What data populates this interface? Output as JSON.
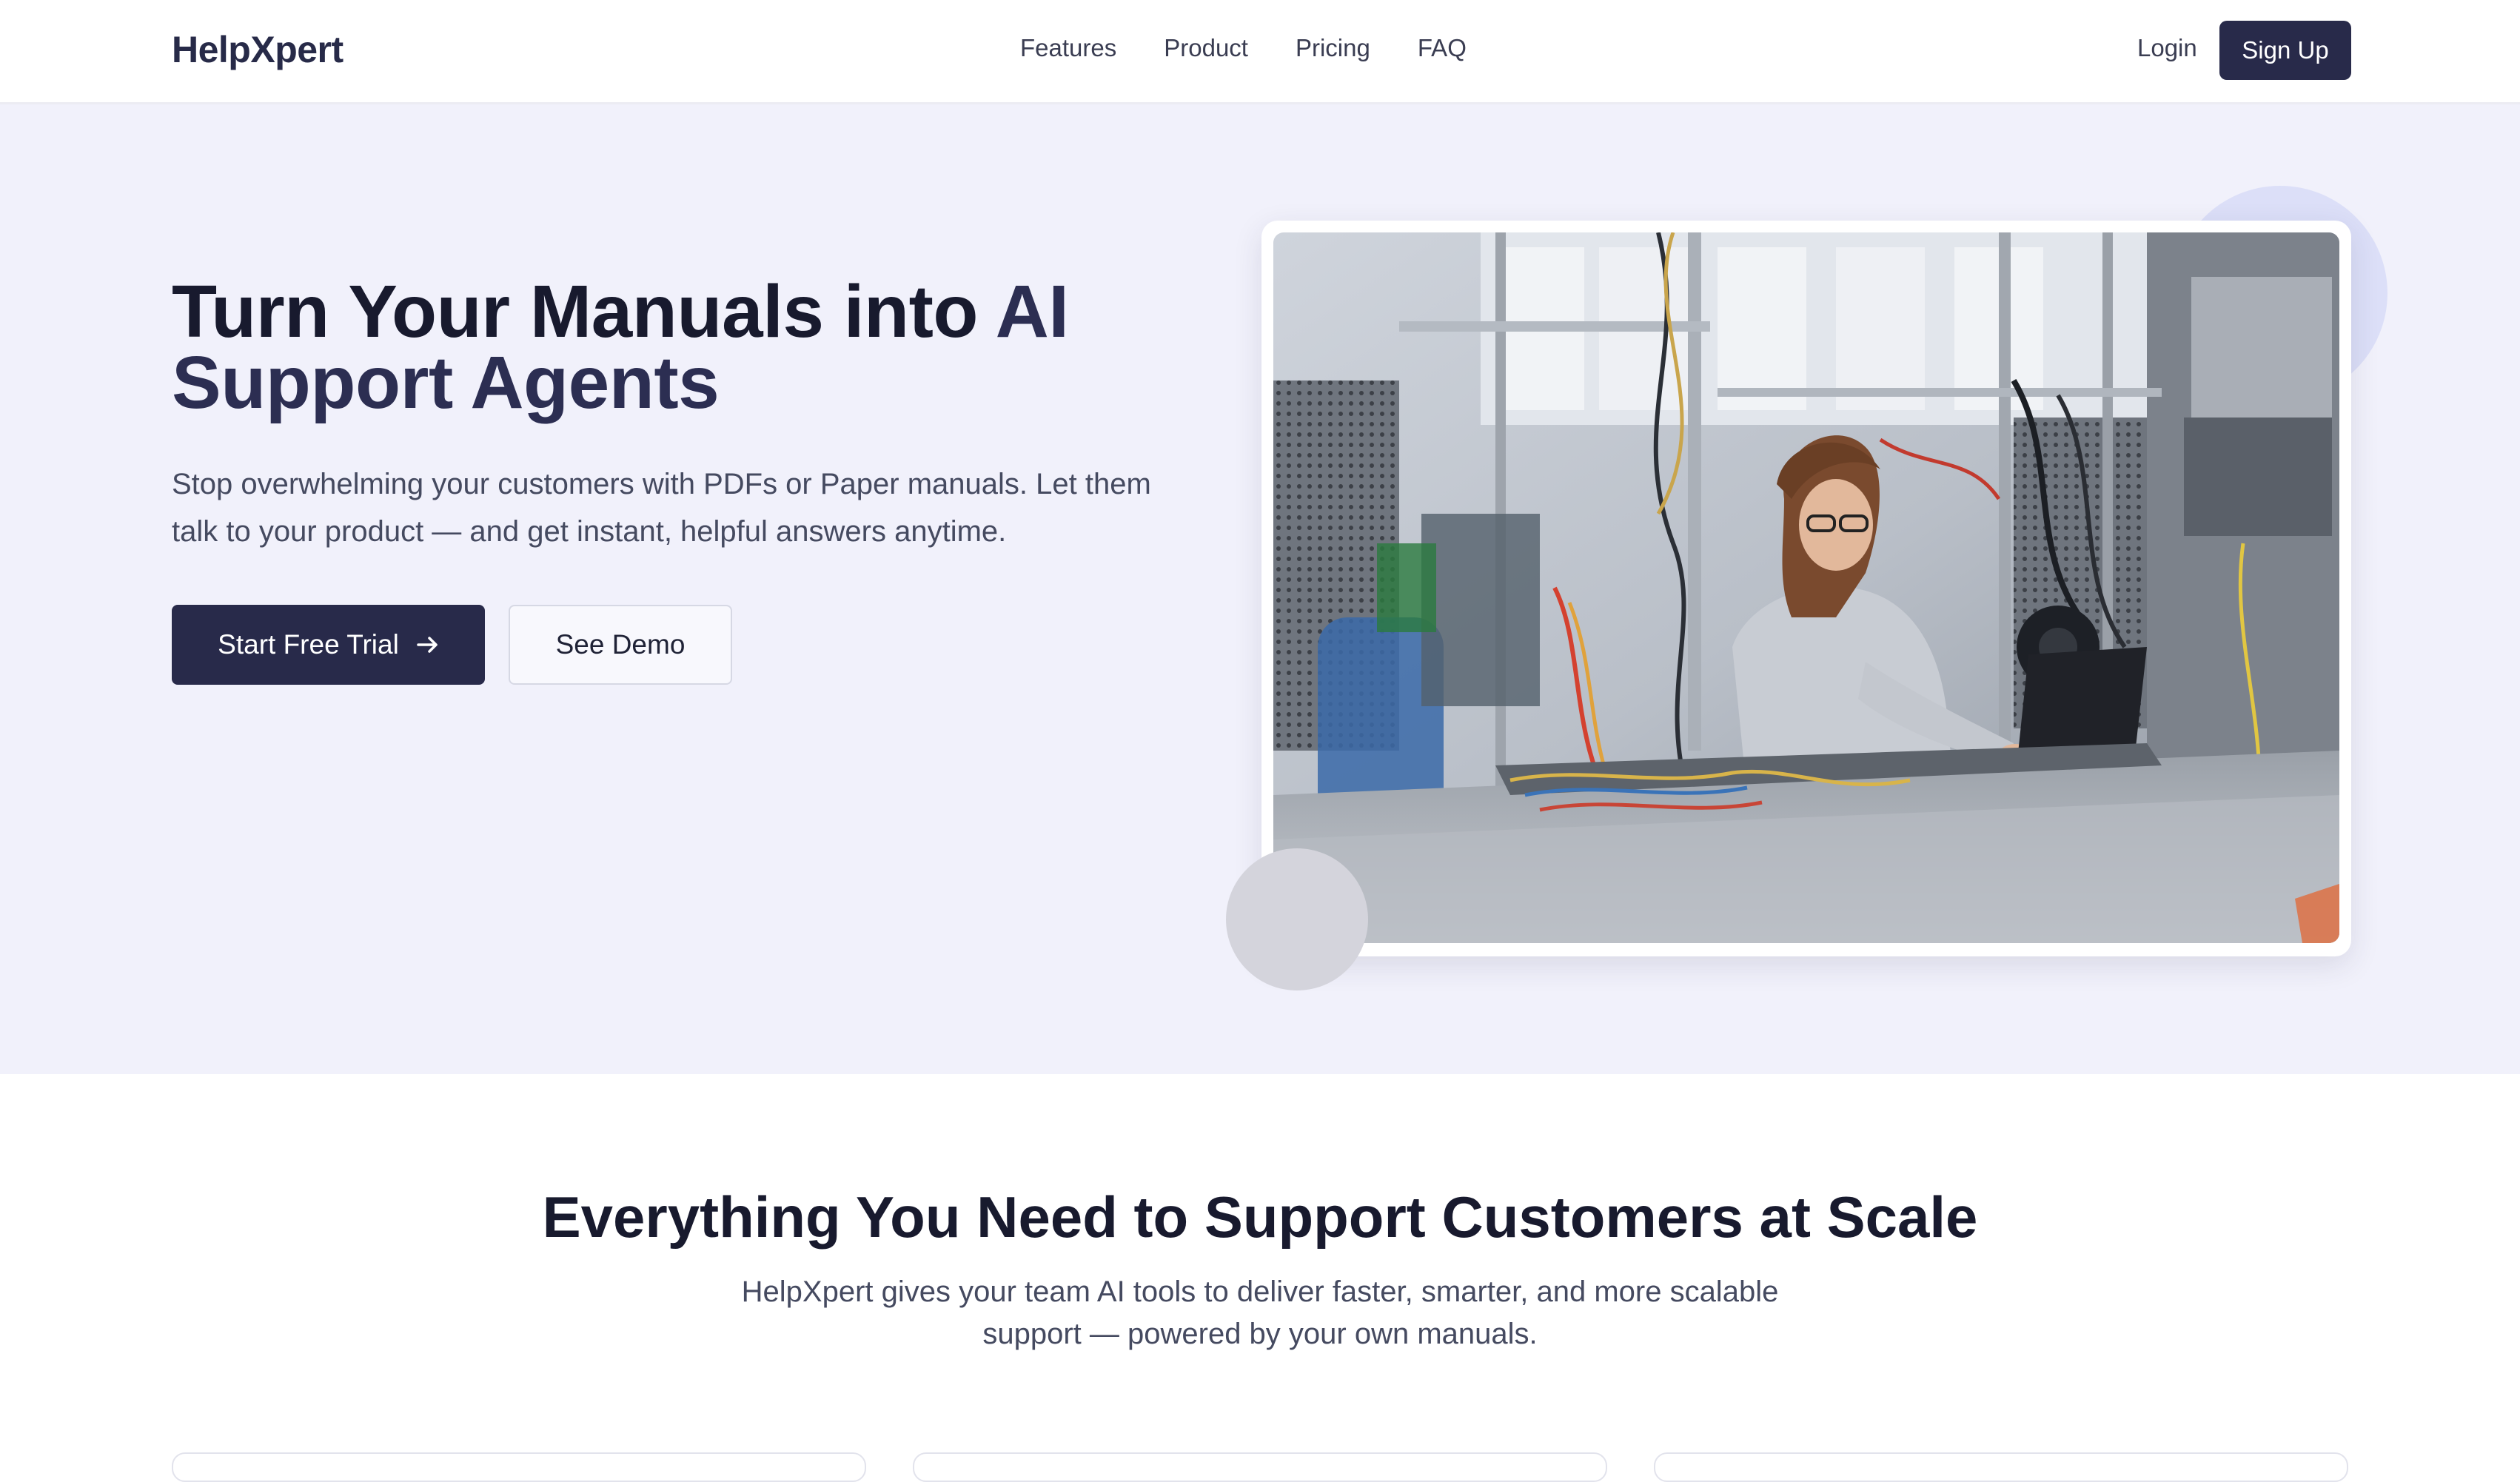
{
  "nav": {
    "logo": "HelpXpert",
    "links": [
      "Features",
      "Product",
      "Pricing",
      "FAQ"
    ],
    "login": "Login",
    "signup": "Sign Up"
  },
  "hero": {
    "title_line1": "Turn Your Manuals into ",
    "title_accent": "AI",
    "title_line2": "Support Agents",
    "subtitle": "Stop overwhelming your customers with PDFs or Paper manuals. Let them talk to your product — and get instant, helpful answers anytime.",
    "primary_cta": "Start Free Trial",
    "primary_cta_icon": "arrow-right-icon",
    "secondary_cta": "See Demo"
  },
  "features": {
    "title": "Everything You Need to Support Customers at Scale",
    "subtitle": "HelpXpert gives your team AI tools to deliver faster, smarter, and more scalable support — powered by your own manuals."
  },
  "colors": {
    "brand_dark": "#282a4a",
    "hero_bg": "#f1f1fb",
    "accent_blob": "#dcdff8"
  }
}
